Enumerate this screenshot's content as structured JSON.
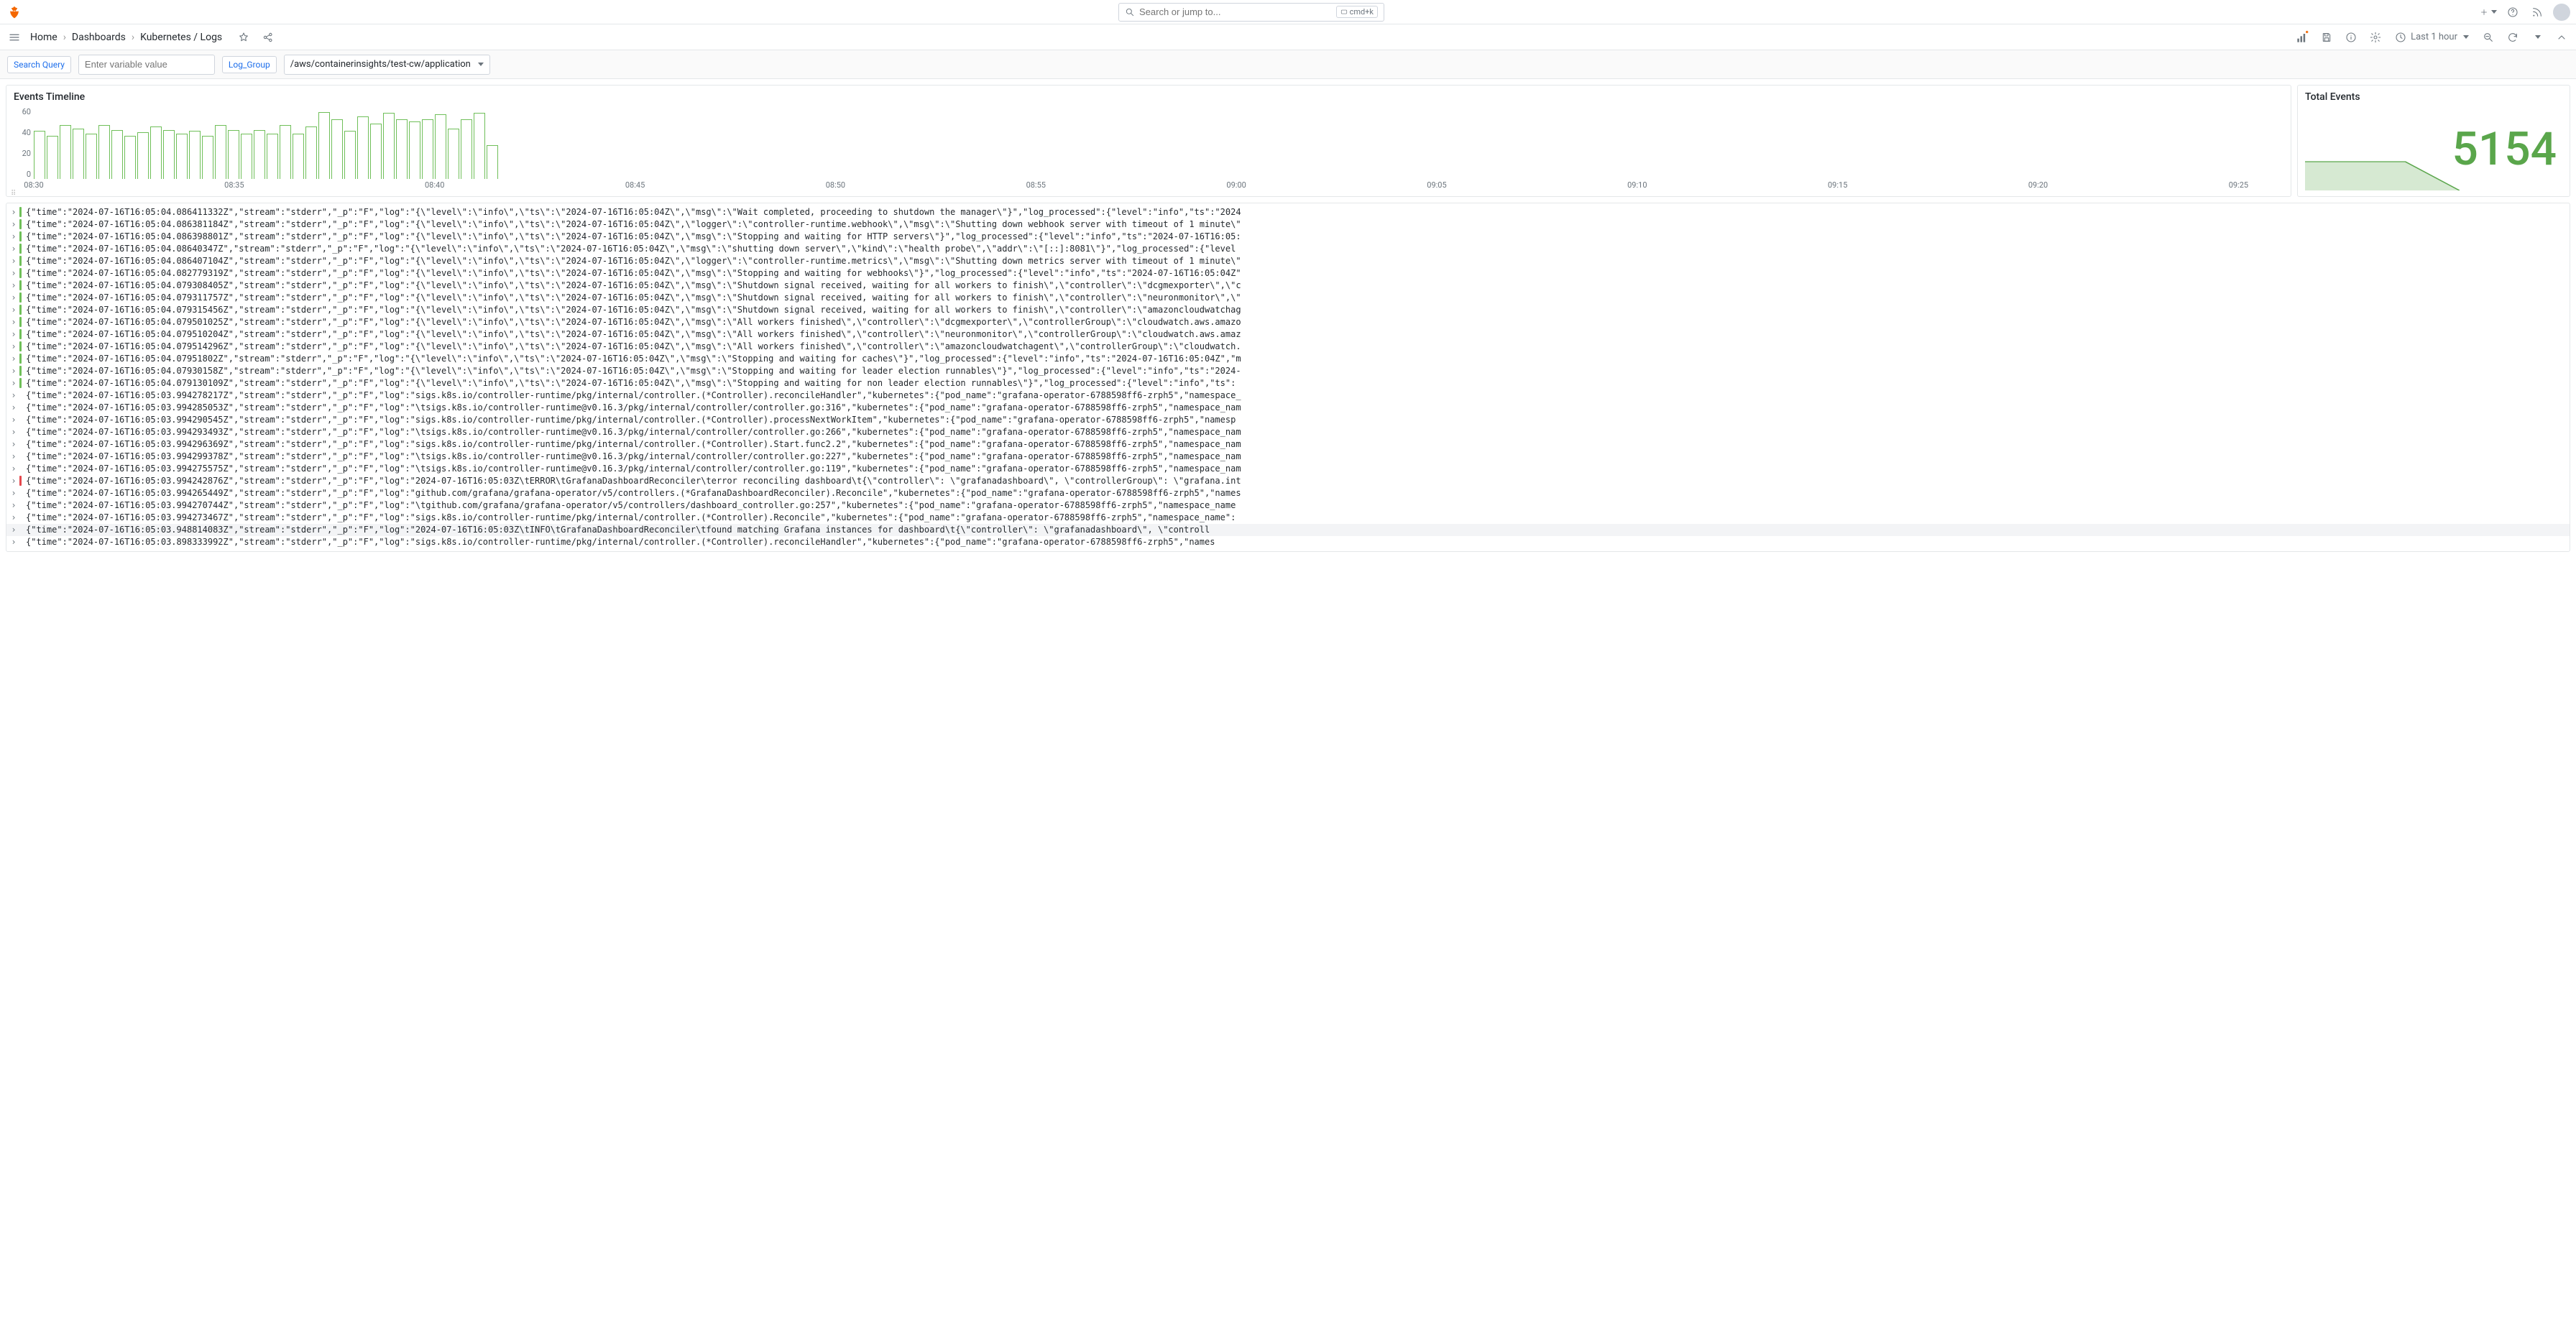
{
  "search": {
    "placeholder": "Search or jump to...",
    "shortcut": "cmd+k"
  },
  "breadcrumbs": {
    "home": "Home",
    "dashboards": "Dashboards",
    "current": "Kubernetes / Logs"
  },
  "time_range": "Last 1 hour",
  "vars": {
    "search_query_label": "Search Query",
    "search_query_placeholder": "Enter variable value",
    "log_group_label": "Log_Group",
    "log_group_value": "/aws/containerinsights/test-cw/application"
  },
  "panels": {
    "timeline_title": "Events Timeline",
    "total_title": "Total Events",
    "total_value": "5154"
  },
  "chart_data": {
    "type": "bar",
    "ylabel": "",
    "ylim": [
      0,
      60
    ],
    "y_ticks": [
      "60",
      "40",
      "20",
      "0"
    ],
    "x_ticks": [
      "08:30",
      "08:35",
      "08:40",
      "08:45",
      "08:50",
      "08:55",
      "09:00",
      "09:05",
      "09:10",
      "09:15",
      "09:20",
      "09:25"
    ],
    "values": [
      40,
      36,
      45,
      42,
      38,
      45,
      41,
      36,
      39,
      44,
      41,
      38,
      40,
      36,
      45,
      41,
      38,
      41,
      38,
      45,
      38,
      44,
      56,
      50,
      40,
      52,
      46,
      55,
      50,
      48,
      50,
      54,
      42,
      50,
      55,
      28
    ]
  },
  "logs": [
    {
      "lv": "info",
      "t": "{\"time\":\"2024-07-16T16:05:04.086411332Z\",\"stream\":\"stderr\",\"_p\":\"F\",\"log\":\"{\\\"level\\\":\\\"info\\\",\\\"ts\\\":\\\"2024-07-16T16:05:04Z\\\",\\\"msg\\\":\\\"Wait completed, proceeding to shutdown the manager\\\"}\",\"log_processed\":{\"level\":\"info\",\"ts\":\"2024"
    },
    {
      "lv": "info",
      "t": "{\"time\":\"2024-07-16T16:05:04.086381184Z\",\"stream\":\"stderr\",\"_p\":\"F\",\"log\":\"{\\\"level\\\":\\\"info\\\",\\\"ts\\\":\\\"2024-07-16T16:05:04Z\\\",\\\"logger\\\":\\\"controller-runtime.webhook\\\",\\\"msg\\\":\\\"Shutting down webhook server with timeout of 1 minute\\\""
    },
    {
      "lv": "info",
      "t": "{\"time\":\"2024-07-16T16:05:04.086398801Z\",\"stream\":\"stderr\",\"_p\":\"F\",\"log\":\"{\\\"level\\\":\\\"info\\\",\\\"ts\\\":\\\"2024-07-16T16:05:04Z\\\",\\\"msg\\\":\\\"Stopping and waiting for HTTP servers\\\"}\",\"log_processed\":{\"level\":\"info\",\"ts\":\"2024-07-16T16:05:"
    },
    {
      "lv": "info",
      "t": "{\"time\":\"2024-07-16T16:05:04.08640347Z\",\"stream\":\"stderr\",\"_p\":\"F\",\"log\":\"{\\\"level\\\":\\\"info\\\",\\\"ts\\\":\\\"2024-07-16T16:05:04Z\\\",\\\"msg\\\":\\\"shutting down server\\\",\\\"kind\\\":\\\"health probe\\\",\\\"addr\\\":\\\"[::]:8081\\\"}\",\"log_processed\":{\"level"
    },
    {
      "lv": "info",
      "t": "{\"time\":\"2024-07-16T16:05:04.086407104Z\",\"stream\":\"stderr\",\"_p\":\"F\",\"log\":\"{\\\"level\\\":\\\"info\\\",\\\"ts\\\":\\\"2024-07-16T16:05:04Z\\\",\\\"logger\\\":\\\"controller-runtime.metrics\\\",\\\"msg\\\":\\\"Shutting down metrics server with timeout of 1 minute\\\""
    },
    {
      "lv": "info",
      "t": "{\"time\":\"2024-07-16T16:05:04.082779319Z\",\"stream\":\"stderr\",\"_p\":\"F\",\"log\":\"{\\\"level\\\":\\\"info\\\",\\\"ts\\\":\\\"2024-07-16T16:05:04Z\\\",\\\"msg\\\":\\\"Stopping and waiting for webhooks\\\"}\",\"log_processed\":{\"level\":\"info\",\"ts\":\"2024-07-16T16:05:04Z\""
    },
    {
      "lv": "info",
      "t": "{\"time\":\"2024-07-16T16:05:04.079308405Z\",\"stream\":\"stderr\",\"_p\":\"F\",\"log\":\"{\\\"level\\\":\\\"info\\\",\\\"ts\\\":\\\"2024-07-16T16:05:04Z\\\",\\\"msg\\\":\\\"Shutdown signal received, waiting for all workers to finish\\\",\\\"controller\\\":\\\"dcgmexporter\\\",\\\"c"
    },
    {
      "lv": "info",
      "t": "{\"time\":\"2024-07-16T16:05:04.079311757Z\",\"stream\":\"stderr\",\"_p\":\"F\",\"log\":\"{\\\"level\\\":\\\"info\\\",\\\"ts\\\":\\\"2024-07-16T16:05:04Z\\\",\\\"msg\\\":\\\"Shutdown signal received, waiting for all workers to finish\\\",\\\"controller\\\":\\\"neuronmonitor\\\",\\\""
    },
    {
      "lv": "info",
      "t": "{\"time\":\"2024-07-16T16:05:04.079315456Z\",\"stream\":\"stderr\",\"_p\":\"F\",\"log\":\"{\\\"level\\\":\\\"info\\\",\\\"ts\\\":\\\"2024-07-16T16:05:04Z\\\",\\\"msg\\\":\\\"Shutdown signal received, waiting for all workers to finish\\\",\\\"controller\\\":\\\"amazoncloudwatchag"
    },
    {
      "lv": "info",
      "t": "{\"time\":\"2024-07-16T16:05:04.079501025Z\",\"stream\":\"stderr\",\"_p\":\"F\",\"log\":\"{\\\"level\\\":\\\"info\\\",\\\"ts\\\":\\\"2024-07-16T16:05:04Z\\\",\\\"msg\\\":\\\"All workers finished\\\",\\\"controller\\\":\\\"dcgmexporter\\\",\\\"controllerGroup\\\":\\\"cloudwatch.aws.amazo"
    },
    {
      "lv": "info",
      "t": "{\"time\":\"2024-07-16T16:05:04.079510204Z\",\"stream\":\"stderr\",\"_p\":\"F\",\"log\":\"{\\\"level\\\":\\\"info\\\",\\\"ts\\\":\\\"2024-07-16T16:05:04Z\\\",\\\"msg\\\":\\\"All workers finished\\\",\\\"controller\\\":\\\"neuronmonitor\\\",\\\"controllerGroup\\\":\\\"cloudwatch.aws.amaz"
    },
    {
      "lv": "info",
      "t": "{\"time\":\"2024-07-16T16:05:04.079514296Z\",\"stream\":\"stderr\",\"_p\":\"F\",\"log\":\"{\\\"level\\\":\\\"info\\\",\\\"ts\\\":\\\"2024-07-16T16:05:04Z\\\",\\\"msg\\\":\\\"All workers finished\\\",\\\"controller\\\":\\\"amazoncloudwatchagent\\\",\\\"controllerGroup\\\":\\\"cloudwatch."
    },
    {
      "lv": "info",
      "t": "{\"time\":\"2024-07-16T16:05:04.07951802Z\",\"stream\":\"stderr\",\"_p\":\"F\",\"log\":\"{\\\"level\\\":\\\"info\\\",\\\"ts\\\":\\\"2024-07-16T16:05:04Z\\\",\\\"msg\\\":\\\"Stopping and waiting for caches\\\"}\",\"log_processed\":{\"level\":\"info\",\"ts\":\"2024-07-16T16:05:04Z\",\"m"
    },
    {
      "lv": "info",
      "t": "{\"time\":\"2024-07-16T16:05:04.07930158Z\",\"stream\":\"stderr\",\"_p\":\"F\",\"log\":\"{\\\"level\\\":\\\"info\\\",\\\"ts\\\":\\\"2024-07-16T16:05:04Z\\\",\\\"msg\\\":\\\"Stopping and waiting for leader election runnables\\\"}\",\"log_processed\":{\"level\":\"info\",\"ts\":\"2024-"
    },
    {
      "lv": "info",
      "t": "{\"time\":\"2024-07-16T16:05:04.079130109Z\",\"stream\":\"stderr\",\"_p\":\"F\",\"log\":\"{\\\"level\\\":\\\"info\\\",\\\"ts\\\":\\\"2024-07-16T16:05:04Z\\\",\\\"msg\\\":\\\"Stopping and waiting for non leader election runnables\\\"}\",\"log_processed\":{\"level\":\"info\",\"ts\":"
    },
    {
      "lv": "noop",
      "t": "{\"time\":\"2024-07-16T16:05:03.994278217Z\",\"stream\":\"stderr\",\"_p\":\"F\",\"log\":\"sigs.k8s.io/controller-runtime/pkg/internal/controller.(*Controller).reconcileHandler\",\"kubernetes\":{\"pod_name\":\"grafana-operator-6788598ff6-zrph5\",\"namespace_"
    },
    {
      "lv": "noop",
      "t": "{\"time\":\"2024-07-16T16:05:03.994285053Z\",\"stream\":\"stderr\",\"_p\":\"F\",\"log\":\"\\tsigs.k8s.io/controller-runtime@v0.16.3/pkg/internal/controller/controller.go:316\",\"kubernetes\":{\"pod_name\":\"grafana-operator-6788598ff6-zrph5\",\"namespace_nam"
    },
    {
      "lv": "noop",
      "t": "{\"time\":\"2024-07-16T16:05:03.994290545Z\",\"stream\":\"stderr\",\"_p\":\"F\",\"log\":\"sigs.k8s.io/controller-runtime/pkg/internal/controller.(*Controller).processNextWorkItem\",\"kubernetes\":{\"pod_name\":\"grafana-operator-6788598ff6-zrph5\",\"namesp"
    },
    {
      "lv": "noop",
      "t": "{\"time\":\"2024-07-16T16:05:03.994293493Z\",\"stream\":\"stderr\",\"_p\":\"F\",\"log\":\"\\tsigs.k8s.io/controller-runtime@v0.16.3/pkg/internal/controller/controller.go:266\",\"kubernetes\":{\"pod_name\":\"grafana-operator-6788598ff6-zrph5\",\"namespace_nam"
    },
    {
      "lv": "noop",
      "t": "{\"time\":\"2024-07-16T16:05:03.994296369Z\",\"stream\":\"stderr\",\"_p\":\"F\",\"log\":\"sigs.k8s.io/controller-runtime/pkg/internal/controller.(*Controller).Start.func2.2\",\"kubernetes\":{\"pod_name\":\"grafana-operator-6788598ff6-zrph5\",\"namespace_nam"
    },
    {
      "lv": "noop",
      "t": "{\"time\":\"2024-07-16T16:05:03.994299378Z\",\"stream\":\"stderr\",\"_p\":\"F\",\"log\":\"\\tsigs.k8s.io/controller-runtime@v0.16.3/pkg/internal/controller/controller.go:227\",\"kubernetes\":{\"pod_name\":\"grafana-operator-6788598ff6-zrph5\",\"namespace_nam"
    },
    {
      "lv": "noop",
      "t": "{\"time\":\"2024-07-16T16:05:03.994275575Z\",\"stream\":\"stderr\",\"_p\":\"F\",\"log\":\"\\tsigs.k8s.io/controller-runtime@v0.16.3/pkg/internal/controller/controller.go:119\",\"kubernetes\":{\"pod_name\":\"grafana-operator-6788598ff6-zrph5\",\"namespace_nam"
    },
    {
      "lv": "err",
      "t": "{\"time\":\"2024-07-16T16:05:03.994242876Z\",\"stream\":\"stderr\",\"_p\":\"F\",\"log\":\"2024-07-16T16:05:03Z\\tERROR\\tGrafanaDashboardReconciler\\terror reconciling dashboard\\t{\\\"controller\\\": \\\"grafanadashboard\\\", \\\"controllerGroup\\\": \\\"grafana.int"
    },
    {
      "lv": "noop",
      "t": "{\"time\":\"2024-07-16T16:05:03.994265449Z\",\"stream\":\"stderr\",\"_p\":\"F\",\"log\":\"github.com/grafana/grafana-operator/v5/controllers.(*GrafanaDashboardReconciler).Reconcile\",\"kubernetes\":{\"pod_name\":\"grafana-operator-6788598ff6-zrph5\",\"names"
    },
    {
      "lv": "noop",
      "t": "{\"time\":\"2024-07-16T16:05:03.994270744Z\",\"stream\":\"stderr\",\"_p\":\"F\",\"log\":\"\\tgithub.com/grafana/grafana-operator/v5/controllers/dashboard_controller.go:257\",\"kubernetes\":{\"pod_name\":\"grafana-operator-6788598ff6-zrph5\",\"namespace_name"
    },
    {
      "lv": "noop",
      "t": "{\"time\":\"2024-07-16T16:05:03.994273467Z\",\"stream\":\"stderr\",\"_p\":\"F\",\"log\":\"sigs.k8s.io/controller-runtime/pkg/internal/controller.(*Controller).Reconcile\",\"kubernetes\":{\"pod_name\":\"grafana-operator-6788598ff6-zrph5\",\"namespace_name\":"
    },
    {
      "lv": "noop",
      "hl": true,
      "t": "{\"time\":\"2024-07-16T16:05:03.948814083Z\",\"stream\":\"stderr\",\"_p\":\"F\",\"log\":\"2024-07-16T16:05:03Z\\tINFO\\tGrafanaDashboardReconciler\\tfound matching Grafana instances for dashboard\\t{\\\"controller\\\": \\\"grafanadashboard\\\", \\\"controll"
    },
    {
      "lv": "noop",
      "t": "{\"time\":\"2024-07-16T16:05:03.898333992Z\",\"stream\":\"stderr\",\"_p\":\"F\",\"log\":\"sigs.k8s.io/controller-runtime/pkg/internal/controller.(*Controller).reconcileHandler\",\"kubernetes\":{\"pod_name\":\"grafana-operator-6788598ff6-zrph5\",\"names"
    }
  ]
}
